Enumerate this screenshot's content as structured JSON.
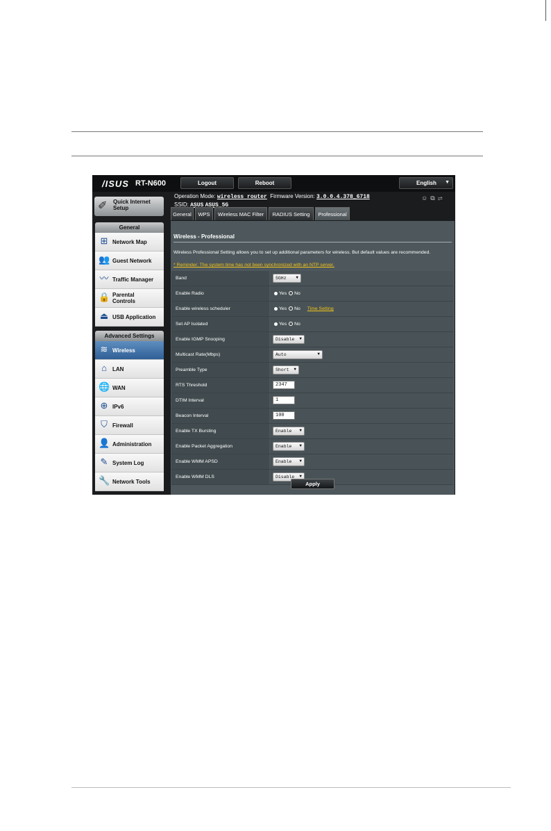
{
  "topbar": {
    "logo": "/ISUS",
    "model": "RT-N600",
    "logout": "Logout",
    "reboot": "Reboot",
    "language": "English"
  },
  "info": {
    "op_mode_label": "Operation Mode:",
    "op_mode_value": "wireless router",
    "firmware_label": "Firmware Version:",
    "firmware_value": "3.0.0.4.378_6718",
    "ssid_label": "SSID:",
    "ssid_1": "ASUS",
    "ssid_2": "ASUS_5G"
  },
  "sidebar": {
    "qis": "Quick Internet Setup",
    "general_title": "General",
    "general_items": [
      "Network Map",
      "Guest Network",
      "Traffic Manager",
      "Parental Controls",
      "USB Application"
    ],
    "advanced_title": "Advanced Settings",
    "advanced_items": [
      "Wireless",
      "LAN",
      "WAN",
      "IPv6",
      "Firewall",
      "Administration",
      "System Log",
      "Network Tools"
    ]
  },
  "tabs": [
    "General",
    "WPS",
    "Wireless MAC Filter",
    "RADIUS Setting",
    "Professional"
  ],
  "content": {
    "title": "Wireless - Professional",
    "description": "Wireless Professional Setting allows you to set up additional parameters for wireless. But default values are recommended.",
    "reminder": "* Reminder: The system time has not been synchronized with an NTP server.",
    "yes": "Yes",
    "no": "No",
    "time_setting": "Time Setting",
    "rows": [
      {
        "label": "Band",
        "value": "5GHz"
      },
      {
        "label": "Enable Radio"
      },
      {
        "label": "Enable wireless scheduler"
      },
      {
        "label": "Set AP Isolated"
      },
      {
        "label": "Enable IGMP Snooping",
        "value": "Disable"
      },
      {
        "label": "Multicast Rate(Mbps)",
        "value": "Auto"
      },
      {
        "label": "Preamble Type",
        "value": "Short"
      },
      {
        "label": "RTS Threshold",
        "value": "2347"
      },
      {
        "label": "DTIM Interval",
        "value": "1"
      },
      {
        "label": "Beacon Interval",
        "value": "100"
      },
      {
        "label": "Enable TX Bursting",
        "value": "Enable"
      },
      {
        "label": "Enable Packet Aggregation",
        "value": "Enable"
      },
      {
        "label": "Enable WMM APSD",
        "value": "Enable"
      },
      {
        "label": "Enable WMM DLS",
        "value": "Disable"
      }
    ],
    "apply": "Apply"
  }
}
